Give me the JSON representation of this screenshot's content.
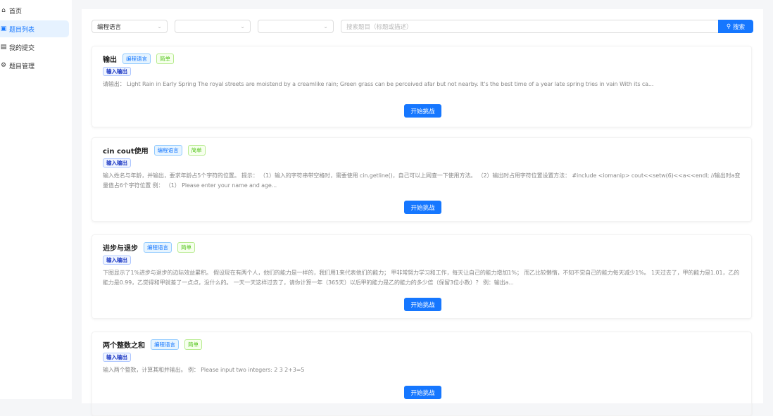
{
  "sidebar": {
    "items": [
      {
        "label": "首页",
        "icon": "home-icon"
      },
      {
        "label": "题目列表",
        "icon": "list-icon",
        "active": true
      },
      {
        "label": "我的提交",
        "icon": "file-icon"
      },
      {
        "label": "题目管理",
        "icon": "gear-icon"
      }
    ]
  },
  "filters": {
    "language": "编程语言",
    "second": "",
    "third": "",
    "search_placeholder": "搜索题目（标题或描述）",
    "search_label": "搜索"
  },
  "problems": [
    {
      "title": "输出",
      "lang": "编程语言",
      "difficulty": "简单",
      "tag": "输入输出",
      "desc": "请输出： Light Rain in Early Spring The royal streets are moistend by a creamlike rain; Green grass can be perceived afar but not nearby. It's the best time of a year late spring tries in vain With its ca...",
      "action": "开始挑战"
    },
    {
      "title": "cin cout使用",
      "lang": "编程语言",
      "difficulty": "简单",
      "tag": "输入输出",
      "desc": "输入姓名与年龄，并输出，要求年龄占5个字符的位置。 提示： （1）输入的字符串带空格时，需要使用 cin.getline()，自己可以上网查一下使用方法。 （2）输出时占用字符位置设置方法： #include <iomanip> cout<<setw(6)<<a<<endl; //输出时a变量值占6个字符位置 例： （1） Please enter your name and age...",
      "action": "开始挑战"
    },
    {
      "title": "进步与退步",
      "lang": "编程语言",
      "difficulty": "简单",
      "tag": "输入输出",
      "desc": "下图显示了1%进步与退步的边际效益累积。 假设现在有两个人，他们的能力是一样的，我们用1来代表他们的能力； 甲非常努力学习和工作，每天让自己的能力增加1%； 而乙比较懒惰，不知不觉自己的能力每天减少1%。 1天过去了，甲的能力是1.01，乙的能力是0.99，乙觉得和甲就差了一点点，没什么的。 一天一天这样过去了，请你计算一年（365天）以后甲的能力是乙的能力的多少倍（保留3位小数）？ 例：输出a...",
      "action": "开始挑战"
    },
    {
      "title": "两个整数之和",
      "lang": "编程语言",
      "difficulty": "简单",
      "tag": "输入输出",
      "desc": "输入两个整数，计算其和并输出。 例： Please input two integers: 2 3 2+3=5",
      "action": "开始挑战"
    }
  ]
}
